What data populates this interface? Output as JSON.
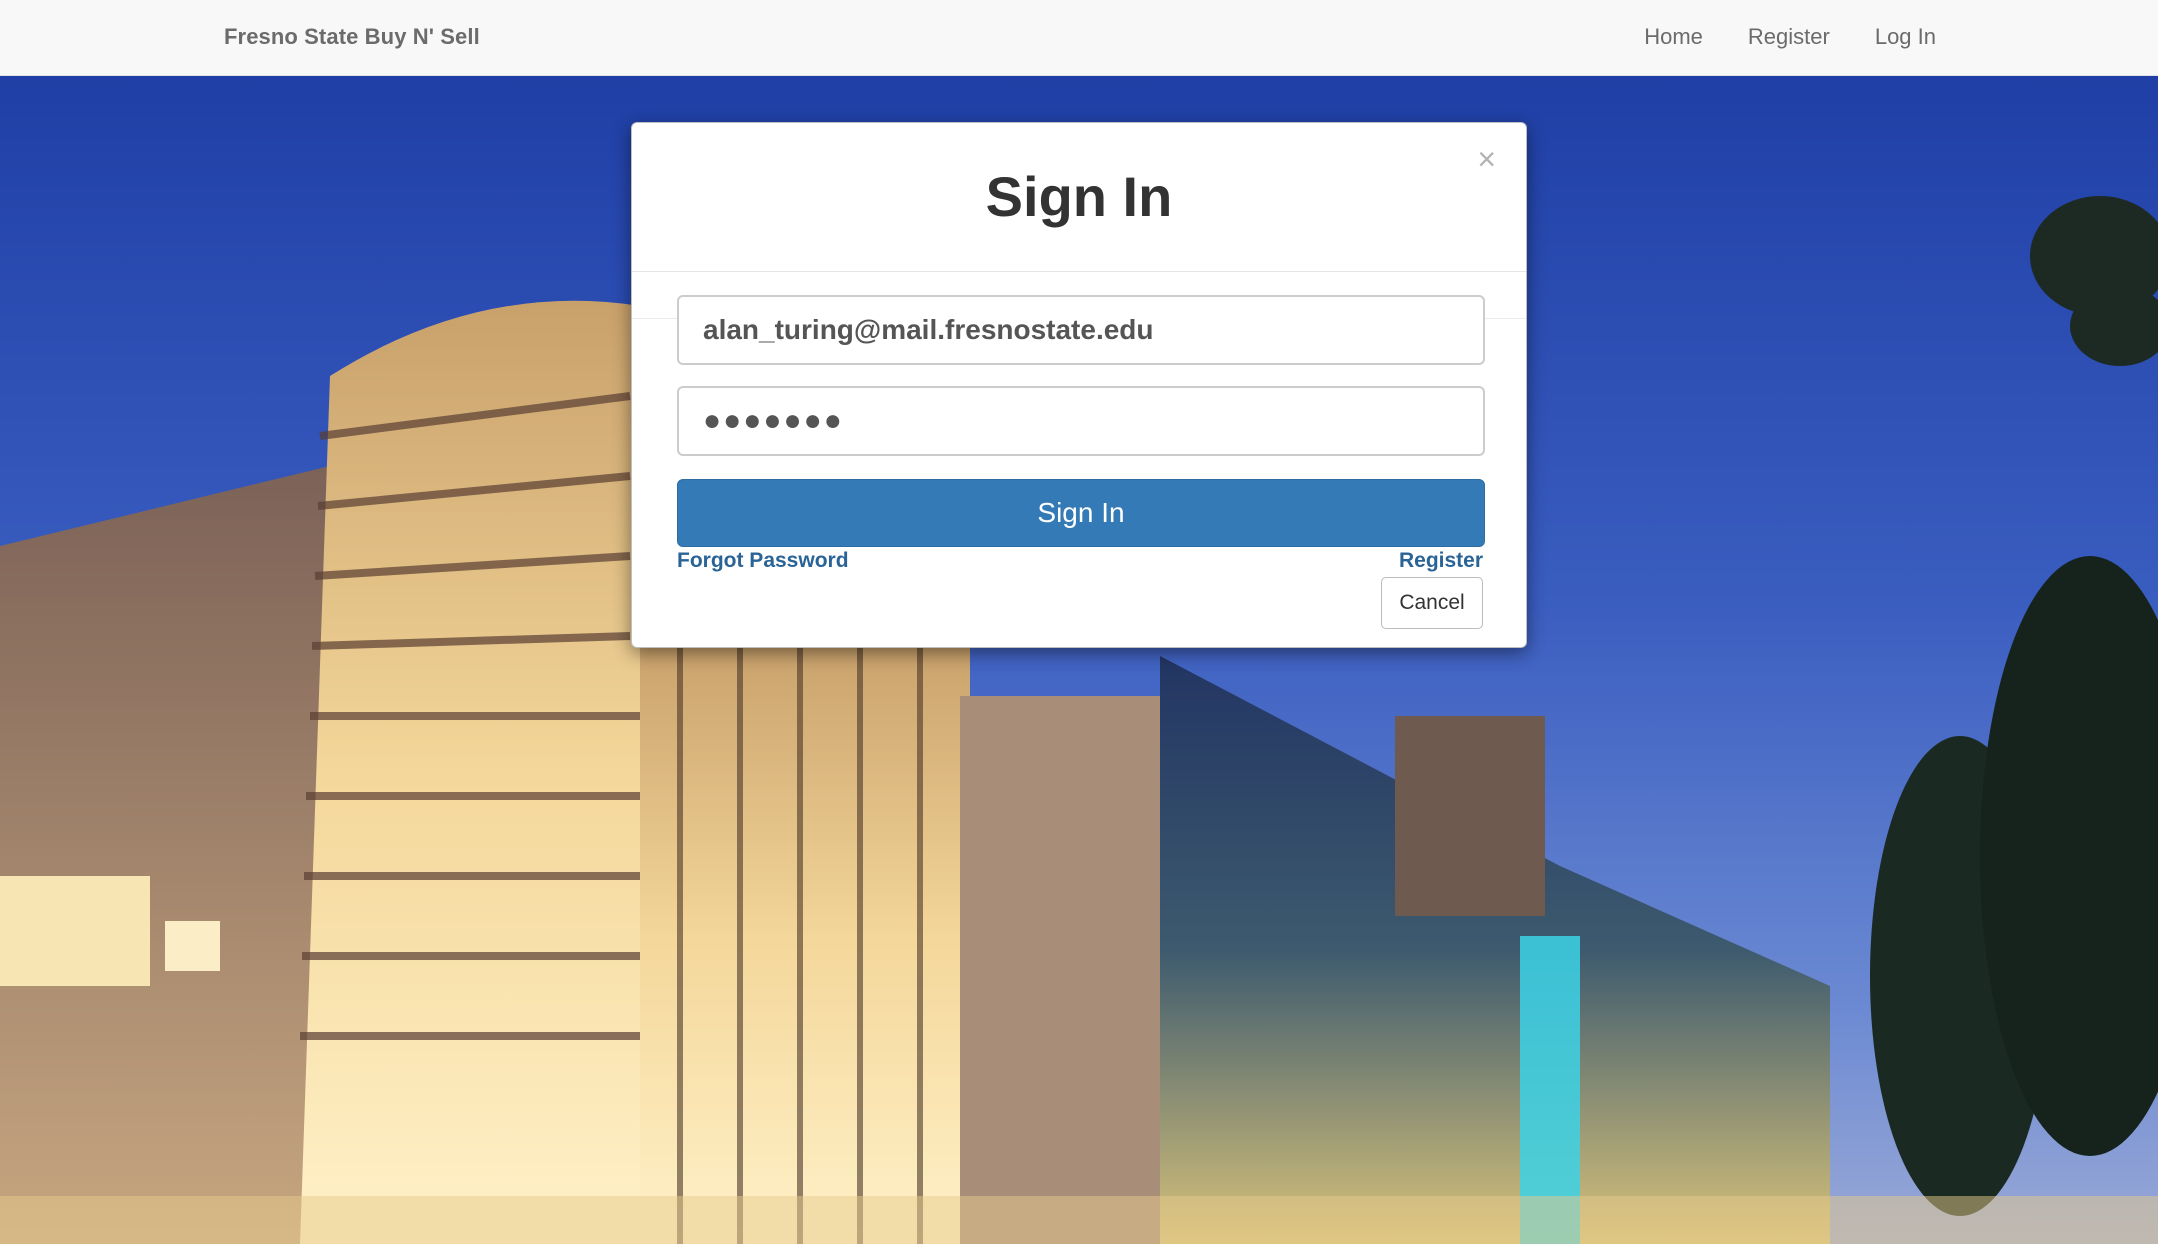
{
  "navbar": {
    "brand": "Fresno State Buy N' Sell",
    "links": [
      "Home",
      "Register",
      "Log In"
    ]
  },
  "modal": {
    "title": "Sign In",
    "close_icon": "×",
    "email_value": "alan_turing@mail.fresnostate.edu",
    "password_value": "●●●●●●●",
    "submit_label": "Sign In",
    "forgot_label": "Forgot Password",
    "register_label": "Register",
    "cancel_label": "Cancel"
  },
  "colors": {
    "primary": "#337ab7",
    "link": "#2a6496",
    "navbar_bg": "#f8f8f8",
    "sky": "#2d4fb0"
  }
}
